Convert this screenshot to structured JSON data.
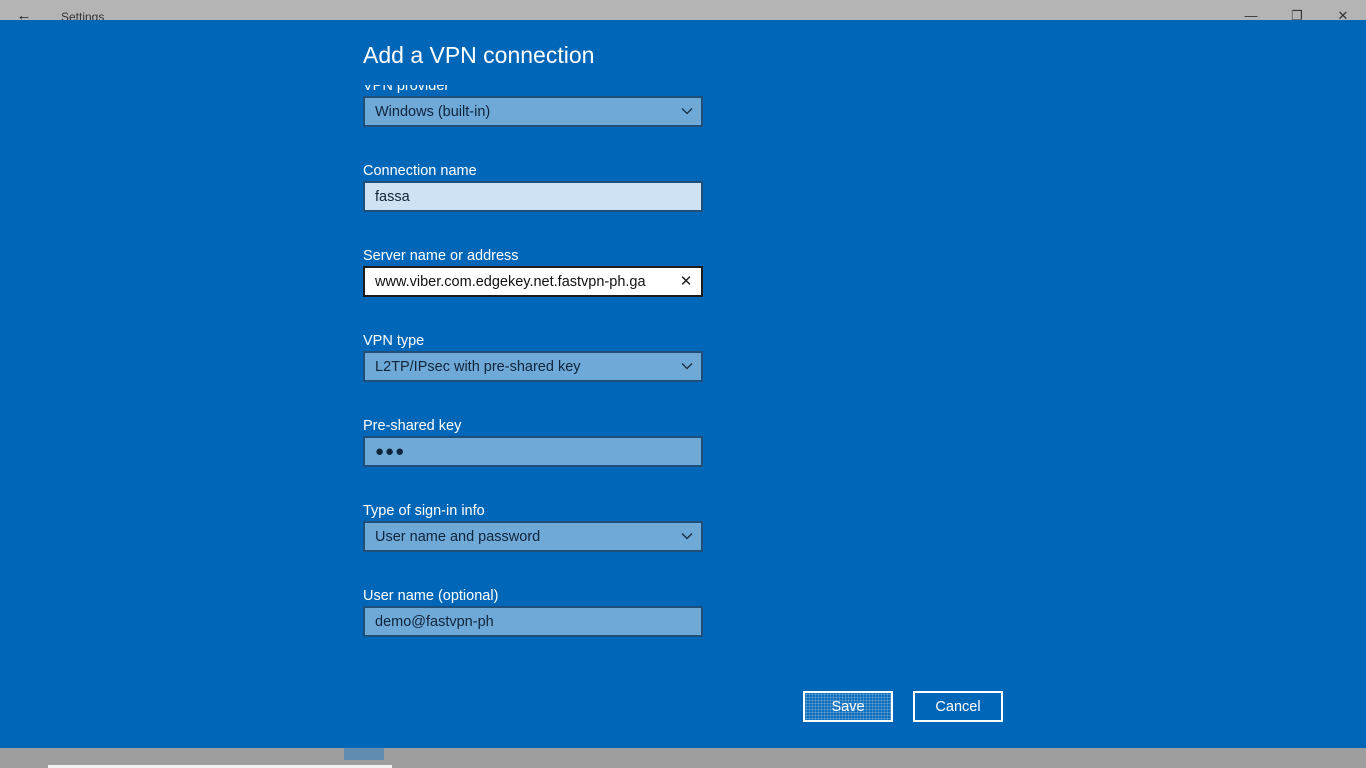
{
  "window": {
    "app_title": "Settings",
    "back_icon": "back-arrow-icon",
    "minimize_glyph": "—",
    "restore_glyph": "❐",
    "close_glyph": "✕"
  },
  "dialog": {
    "title": "Add a VPN connection",
    "fields": {
      "vpn_provider": {
        "label": "VPN provider",
        "value": "Windows (built-in)"
      },
      "connection_name": {
        "label": "Connection name",
        "value": "fassa"
      },
      "server": {
        "label": "Server name or address",
        "value": "www.viber.com.edgekey.net.fastvpn-ph.ga",
        "clear_glyph": "✕"
      },
      "vpn_type": {
        "label": "VPN type",
        "value": "L2TP/IPsec with pre-shared key"
      },
      "pre_shared_key": {
        "label": "Pre-shared key",
        "value": "●●●"
      },
      "sign_in_type": {
        "label": "Type of sign-in info",
        "value": "User name and password"
      },
      "user_name": {
        "label": "User name (optional)",
        "value": "demo@fastvpn-ph"
      }
    },
    "buttons": {
      "save": "Save",
      "cancel": "Cancel"
    }
  },
  "colors": {
    "dialog_bg": "#0067b8",
    "field_bg": "#6ea9d8",
    "field_border": "#1e4e7a",
    "text_light": "#ffffff"
  }
}
